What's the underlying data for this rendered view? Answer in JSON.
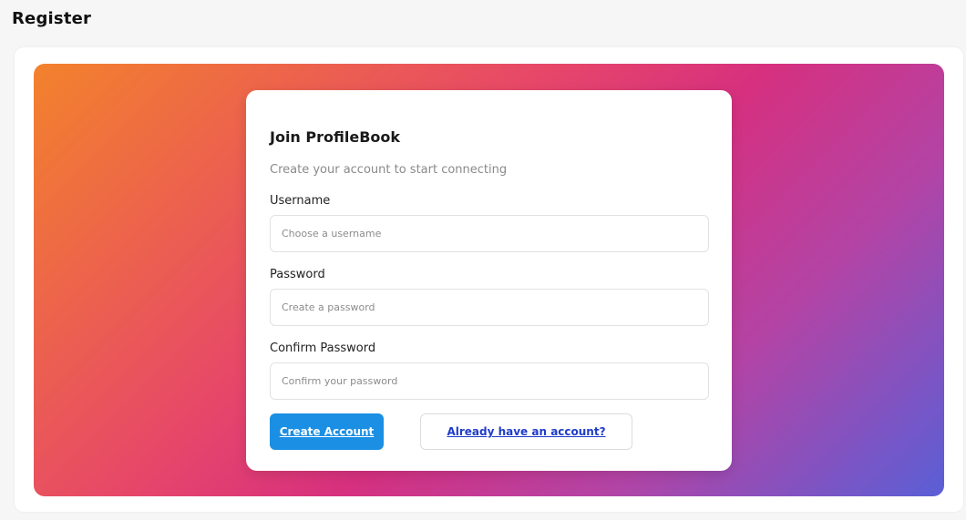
{
  "page": {
    "title": "Register"
  },
  "card": {
    "title": "Join ProfileBook",
    "subtitle": "Create your account to start connecting"
  },
  "form": {
    "username": {
      "label": "Username",
      "placeholder": "Choose a username",
      "value": ""
    },
    "password": {
      "label": "Password",
      "placeholder": "Create a password",
      "value": ""
    },
    "confirm_password": {
      "label": "Confirm Password",
      "placeholder": "Confirm your password",
      "value": ""
    }
  },
  "actions": {
    "create_account_label": "Create Account",
    "login_link_label": "Already have an account?"
  },
  "colors": {
    "primary_button": "#1a8fe3",
    "link": "#1f3cc9",
    "gradient_start": "#f3822c",
    "gradient_mid": "#d6307f",
    "gradient_end": "#5a5fd6"
  }
}
